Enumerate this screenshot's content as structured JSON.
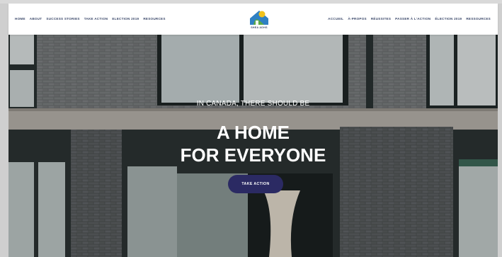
{
  "nav": {
    "left": [
      "HOME",
      "ABOUT",
      "SUCCESS STORIES",
      "TAKE ACTION",
      "ELECTION 2019",
      "RESOURCES"
    ],
    "right": [
      "ACCUEIL",
      "À-PROPOS",
      "RÉUSSITES",
      "PASSER À L'ACTION",
      "ÉLECTION 2019",
      "RESSOURCES"
    ]
  },
  "logo": {
    "text": "SHEA ADHS"
  },
  "hero": {
    "eyebrow": "IN CANADA, THERE SHOULD BE",
    "headline_line1": "A HOME",
    "headline_line2": "FOR EVERYONE",
    "cta_label": "TAKE ACTION"
  },
  "colors": {
    "nav_text": "#3d4a6b",
    "cta_bg": "#2b2a63",
    "logo_blue": "#2f80c3",
    "logo_yellow": "#f2c21b",
    "logo_green": "#5aa946"
  }
}
